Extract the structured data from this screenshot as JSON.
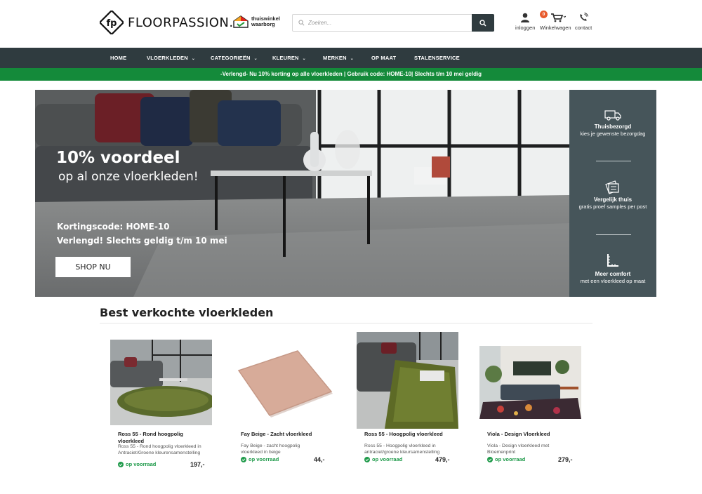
{
  "header": {
    "logo_text": "FLOORPASSION.",
    "trust_badge": [
      "thuiswinkel",
      "waarborg"
    ],
    "search_placeholder": "Zoeken...",
    "login_label": "inloggen",
    "cart_label": "Winkelwagen",
    "cart_count": "0",
    "contact_label": "contact"
  },
  "nav": {
    "items": [
      {
        "label": "HOME",
        "has_dropdown": false
      },
      {
        "label": "VLOERKLEDEN",
        "has_dropdown": true
      },
      {
        "label": "CATEGORIEËN",
        "has_dropdown": true
      },
      {
        "label": "KLEUREN",
        "has_dropdown": true
      },
      {
        "label": "MERKEN",
        "has_dropdown": true
      },
      {
        "label": "OP MAAT",
        "has_dropdown": false
      },
      {
        "label": "STALENSERVICE",
        "has_dropdown": false
      }
    ]
  },
  "promo_bar": "-Verlengd- Nu 10% korting op alle vloerkleden | Gebruik code: HOME-10| Slechts t/m 10 mei geldig",
  "hero": {
    "headline": "10% voordeel",
    "subline": "op al onze vloerkleden!",
    "code_line": "Kortingscode: HOME-10",
    "valid_line": "Verlengd! Slechts geldig t/m 10 mei",
    "button": "SHOP NU",
    "usps": [
      {
        "icon": "truck-icon",
        "title": "Thuisbezorgd",
        "subtitle": "kies je gewenste bezorgdag"
      },
      {
        "icon": "swatches-icon",
        "title": "Vergelijk thuis",
        "subtitle": "gratis proef samples per post"
      },
      {
        "icon": "ruler-icon",
        "title": "Meer comfort",
        "subtitle": "met een vloerkleed op maat"
      }
    ]
  },
  "bestsellers": {
    "title": "Best verkochte vloerkleden",
    "products": [
      {
        "name": "Ross 55 - Rond hoogpolig vloerkleed",
        "description": "Ross 55 - Rond hoogpolig vloerkleed in Antraciet/Groene kleurensamenstelling",
        "stock": "op voorraad",
        "price": "197,-"
      },
      {
        "name": "Fay Beige - Zacht vloerkleed",
        "description": "Fay Beige - zacht hoogpolig vloerkleed in beige",
        "stock": "op voorraad",
        "price": "44,-"
      },
      {
        "name": "Ross 55 - Hoogpolig vloerkleed",
        "description": "Ross 55 - Hoogpolig vloerkleed in antraciet/groene kleursamenstelling",
        "stock": "op voorraad",
        "price": "479,-"
      },
      {
        "name": "Viola - Design Vloerkleed",
        "description": "Viola - Design vloerkleed met Bloemenprint",
        "stock": "op voorraad",
        "price": "279,-"
      }
    ]
  },
  "colors": {
    "nav_bg": "#2f3b3f",
    "promo_bg": "#148a3a",
    "stock_green": "#1f9a4a",
    "cart_badge": "#e85a2c"
  }
}
